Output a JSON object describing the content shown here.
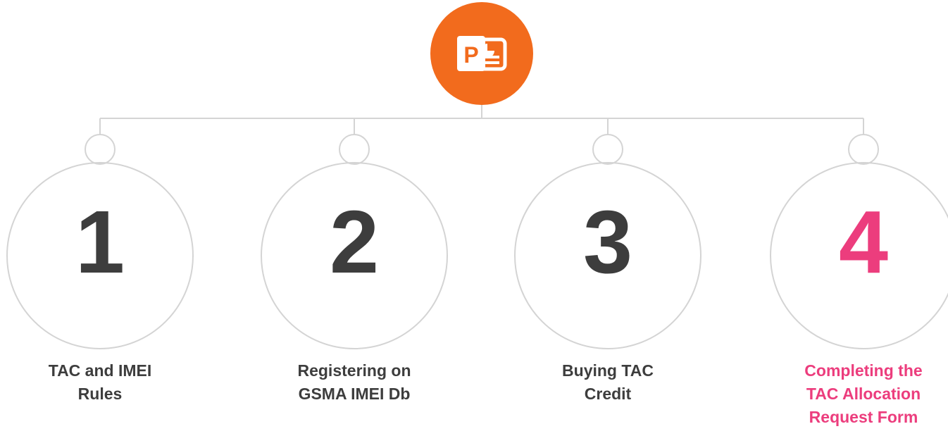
{
  "colors": {
    "hub": "#f26b1d",
    "line": "#d4d4d4",
    "number": "#3d3d3d",
    "label": "#3d3d3d",
    "highlight": "#ec3d7d"
  },
  "hub": {
    "icon": "powerpoint-icon",
    "letter": "P"
  },
  "steps": [
    {
      "number": "1",
      "label_lines": [
        "TAC and IMEI",
        "Rules"
      ],
      "highlight": false
    },
    {
      "number": "2",
      "label_lines": [
        "Registering on",
        "GSMA IMEI Db"
      ],
      "highlight": false
    },
    {
      "number": "3",
      "label_lines": [
        "Buying TAC",
        "Credit"
      ],
      "highlight": false
    },
    {
      "number": "4",
      "label_lines": [
        "Completing the",
        "TAC Allocation",
        "Request Form"
      ],
      "highlight": true
    }
  ]
}
